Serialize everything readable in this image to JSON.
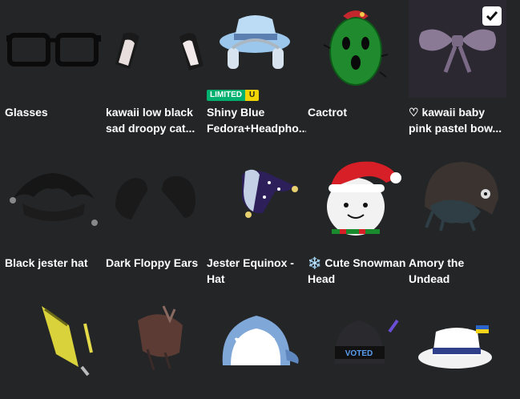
{
  "items": [
    {
      "name": "Glasses"
    },
    {
      "name": "kawaii low black sad droopy cat..."
    },
    {
      "name": "Shiny Blue Fedora+Headpho...",
      "badge": {
        "limited": "LIMITED",
        "u": "U"
      }
    },
    {
      "name": "Cactrot"
    },
    {
      "name": "♡ kawaii baby pink pastel bow...",
      "selected": true
    },
    {
      "name": "Black jester hat"
    },
    {
      "name": "Dark Floppy Ears"
    },
    {
      "name": "Jester Equinox - Hat"
    },
    {
      "name": "❄️ Cute Snowman Head"
    },
    {
      "name": "Amory the Undead Necromancer -..."
    },
    {
      "name": "",
      "badge_text": "VOTED"
    }
  ],
  "icons": {
    "check": "checkmark-icon"
  },
  "colors": {
    "background": "#232527",
    "limited_green": "#00b06f",
    "limited_yellow": "#f2d400"
  }
}
